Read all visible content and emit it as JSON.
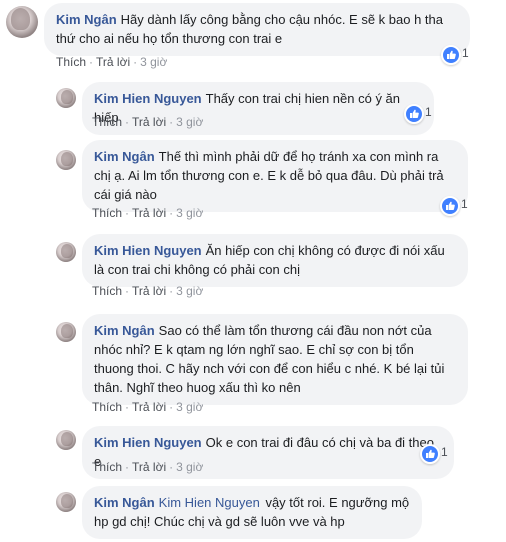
{
  "actions": {
    "like": "Thích",
    "reply": "Trả lời",
    "dot": "·"
  },
  "colors": {
    "link": "#385898",
    "bubble": "#f2f3f5",
    "like_badge": "#4080ff",
    "meta": "#90949c"
  },
  "icons": {
    "like": "thumbs-up-icon",
    "avatar": "profile-photo"
  },
  "comments": [
    {
      "author": "Kim Ngân",
      "text": "Hãy dành lấy công bằng cho cậu nhóc. E sẽ k bao h tha thứ cho ai nếu họ tổn thương con trai e",
      "time": "3 giờ",
      "likes": "1"
    },
    {
      "author": "Kim Hien Nguyen",
      "text": "Thấy con trai chị hien nền có ý ăn hiếp",
      "time": "3 giờ",
      "likes": "1"
    },
    {
      "author": "Kim Ngân",
      "text": "Thế thì mình phải dữ để họ tránh xa con mình ra chị ạ. Ai lm tổn thương con e. E k dễ bỏ qua đâu. Dù phải trả cái giá nào",
      "time": "3 giờ",
      "likes": "1"
    },
    {
      "author": "Kim Hien Nguyen",
      "text": "Ăn hiếp con chị không có được đi nói xấu là con trai chi không có phải con chị",
      "time": "3 giờ",
      "likes": ""
    },
    {
      "author": "Kim Ngân",
      "text": "Sao có thể làm tổn thương cái đầu non nớt của nhóc nhỉ? E k qtam ng lớn nghĩ sao. E chỉ sợ con bị tổn thuong thoi. C hãy nch với con để con hiểu c nhé. K bé lại tủi thân. Nghĩ theo huog xấu thì ko nên",
      "time": "3 giờ",
      "likes": ""
    },
    {
      "author": "Kim Hien Nguyen",
      "text": "Ok e con trai đi đâu có chị và ba đi theo e",
      "time": "3 giờ",
      "likes": "1"
    },
    {
      "author": "Kim Ngân",
      "mention": "Kim Hien Nguyen",
      "text": "vậy tốt roi. E ngưỡng mộ hp gd chị! Chúc chị và gd sẽ luôn vve và hp",
      "time": "",
      "likes": ""
    }
  ]
}
